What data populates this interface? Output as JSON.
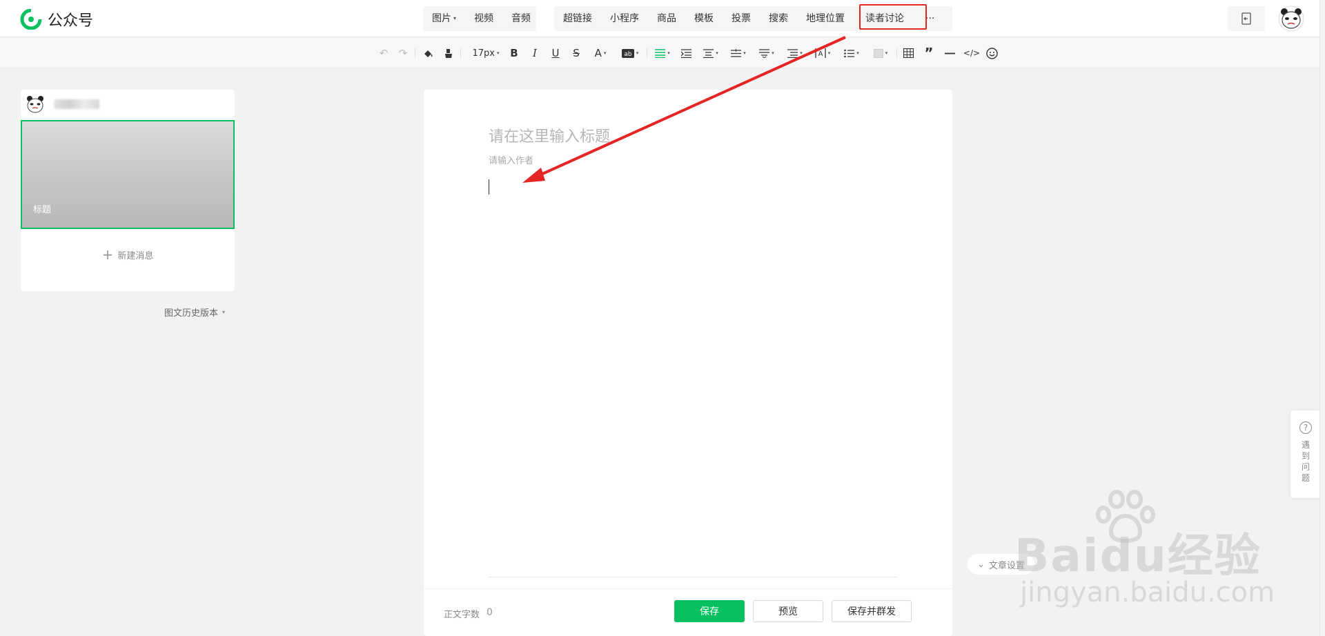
{
  "header": {
    "logo_text": "公众号",
    "media_group": [
      {
        "label": "图片",
        "has_caret": true
      },
      {
        "label": "视频",
        "has_caret": false
      },
      {
        "label": "音频",
        "has_caret": false
      }
    ],
    "insert_group": [
      "超链接",
      "小程序",
      "商品",
      "模板",
      "投票",
      "搜索",
      "地理位置",
      "读者讨论"
    ],
    "highlighted_item": "读者讨论",
    "more_label": "···",
    "icons": [
      "logo-icon",
      "exit-edit-icon",
      "avatar"
    ]
  },
  "toolbar": {
    "font_size": "17px",
    "tools": [
      "undo-icon",
      "redo-icon",
      "format-painter-icon",
      "clear-format-icon",
      "font-size-select",
      "bold-icon",
      "italic-icon",
      "underline-icon",
      "strikethrough-icon",
      "font-color-icon",
      "background-color-icon",
      "align-icon",
      "indent-icon",
      "paragraph-spacing-icon",
      "line-height-icon",
      "spacing-before-icon",
      "spacing-after-icon",
      "letter-spacing-icon",
      "list-icon",
      "border-icon",
      "table-icon",
      "quote-icon",
      "divider-icon",
      "code-icon",
      "emoji-icon"
    ],
    "accent_color": "#07c160"
  },
  "left_panel": {
    "cover_title": "标题",
    "new_message": "新建消息",
    "history_version": "图文历史版本"
  },
  "editor": {
    "title_placeholder": "请在这里输入标题",
    "author_placeholder": "请输入作者",
    "word_count_label": "正文字数",
    "word_count": "0",
    "save": "保存",
    "preview": "预览",
    "save_and_mass_send": "保存并群发"
  },
  "side": {
    "article_settings": "文章设置",
    "help": "遇到问题"
  },
  "watermark": {
    "brand": "Baidu经验",
    "url": "jingyan.baidu.com"
  },
  "colors": {
    "primary": "#07c160",
    "annotation_red": "#e52424"
  }
}
